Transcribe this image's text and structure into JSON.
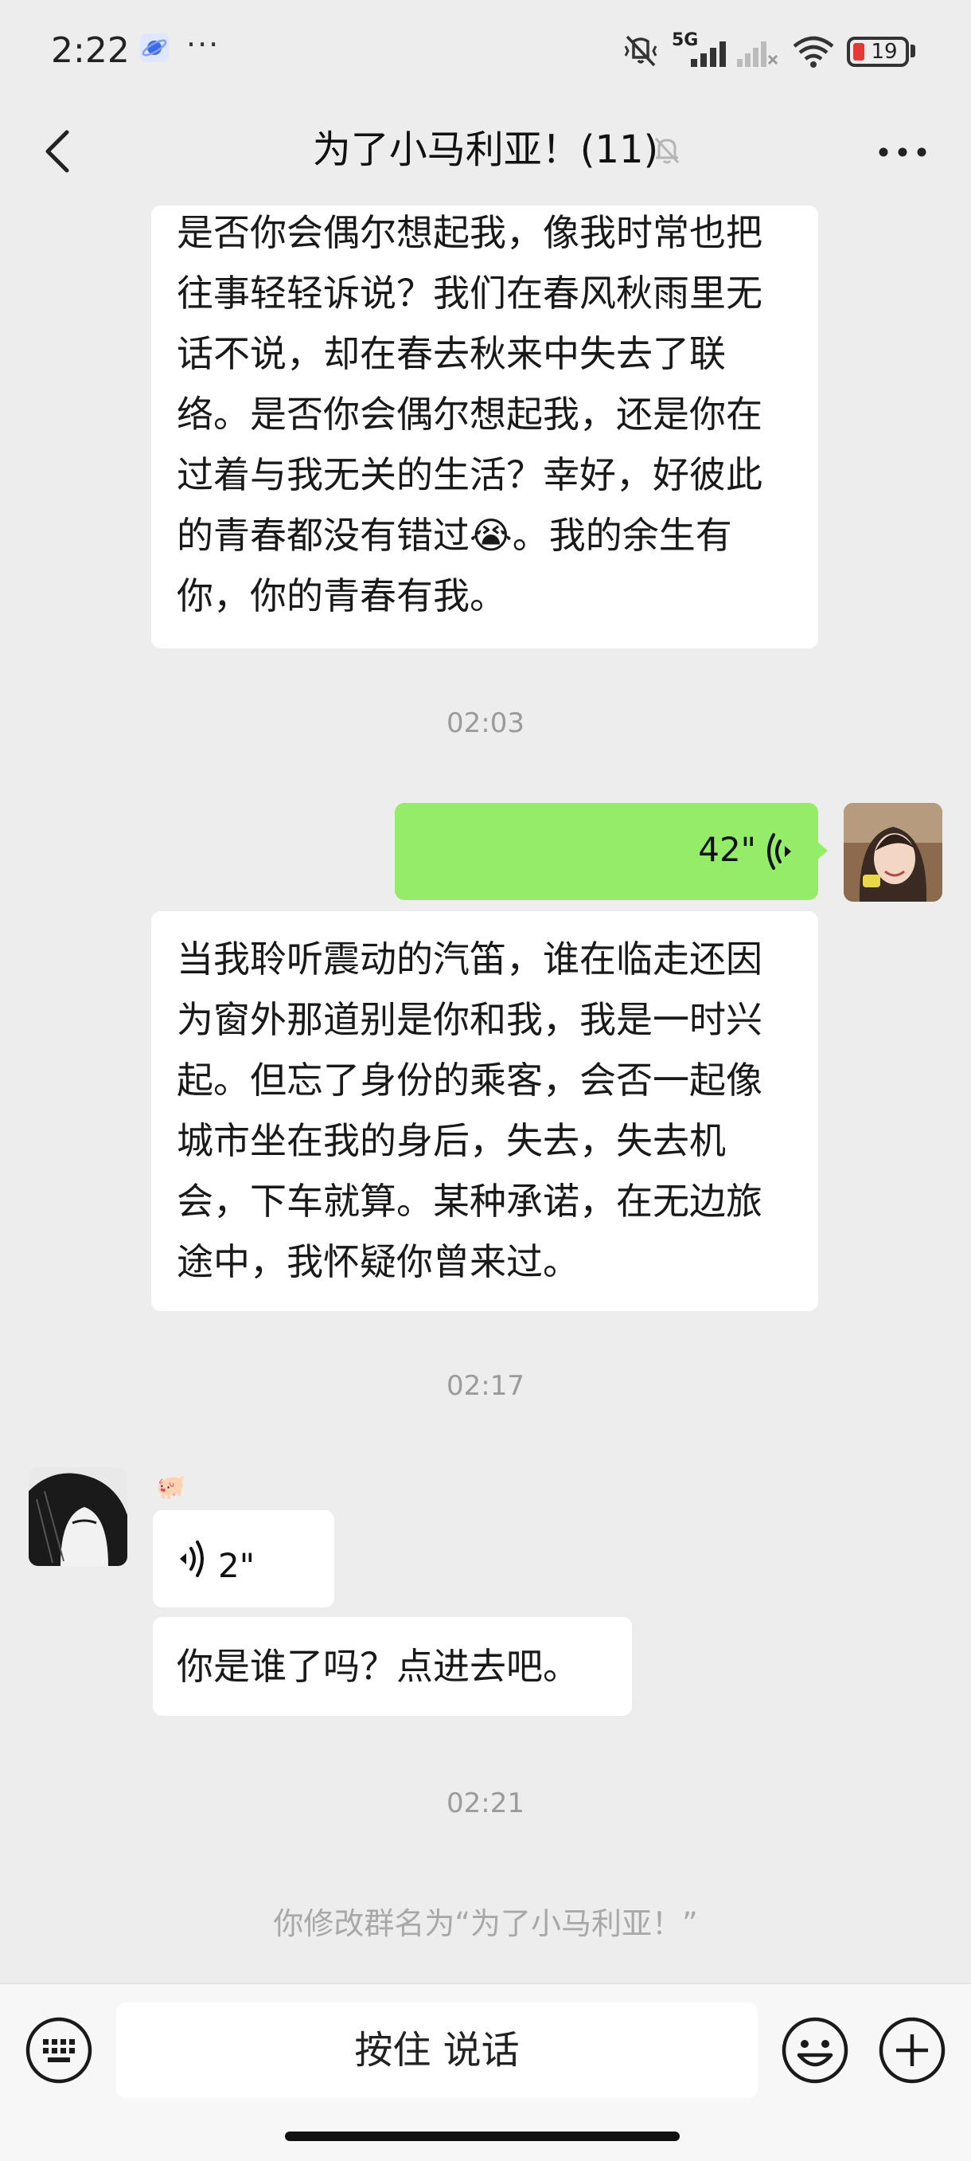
{
  "status_bar": {
    "time": "2:22",
    "more_dots": "···",
    "network": "5G",
    "battery_level": "19",
    "battery_color": "#E53935"
  },
  "header": {
    "title": "为了小马利亚！(11)",
    "back_icon": "chevron-left-icon",
    "mute_icon": "bell-off-icon",
    "more_icon": "more-horizontal-icon"
  },
  "messages": {
    "m1": {
      "sender": "other",
      "text": "是否你会偶尔想起我，像我时常也把往事轻轻诉说？我们在春风秋雨里无话不说，却在春去秋来中失去了联络。是否你会偶尔想起我，还是你在过着与我无关的生活？幸好，好彼此的青春都没有错过😭。我的余生有你，你的青春有我。"
    },
    "t1": "02:03",
    "m2": {
      "sender": "me",
      "type": "voice",
      "duration": "42\"",
      "bubble_color": "#95EC69"
    },
    "m3": {
      "sender": "other",
      "text": "当我聆听震动的汽笛，谁在临走还因为窗外那道别是你和我，我是一时兴起。但忘了身份的乘客，会否一起像城市坐在我的身后，失去，失去机会，下车就算。某种承诺，在无边旅途中，我怀疑你曾来过。"
    },
    "t2": "02:17",
    "m4": {
      "sender": "other",
      "nickname": "🐖",
      "type": "voice",
      "duration": "2\""
    },
    "m5": {
      "sender": "other",
      "text": "你是谁了吗？点进去吧。"
    },
    "t3": "02:21",
    "system": "你修改群名为“为了小马利亚！”"
  },
  "input_bar": {
    "keyboard_icon": "keyboard-icon",
    "hold_to_talk": "按住 说话",
    "emoji_icon": "smiley-icon",
    "plus_icon": "plus-circle-icon"
  }
}
